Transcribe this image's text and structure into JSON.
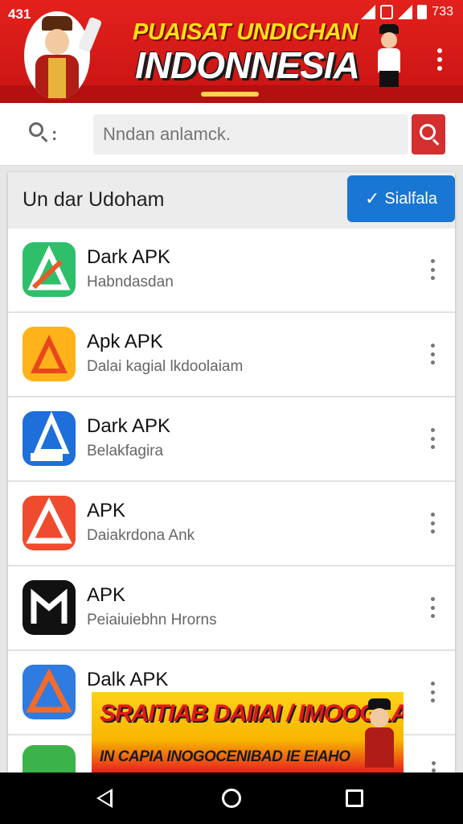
{
  "status_bar": {
    "time_left": "431",
    "time_right": "733"
  },
  "header": {
    "title_top": "PUAISAT UNDICHAN",
    "title_main": "INDONNESIA",
    "colors": {
      "primary": "#e3211d",
      "accent_yellow": "#ffe11a"
    }
  },
  "search": {
    "placeholder": "Nndan anlamck.",
    "icon": "search-icon",
    "button_icon": "search-icon"
  },
  "card": {
    "title": "Un dar Udoham",
    "action_button": {
      "label": "Sialfala",
      "icon": "edit-check-icon",
      "color": "#1976d2"
    }
  },
  "apps": [
    {
      "name": "Dark APK",
      "subtitle": "Habndasdan",
      "icon": "green-a-icon"
    },
    {
      "name": "Apk APK",
      "subtitle": "Dalai kagial lkdoolaiam",
      "icon": "orange-a-icon"
    },
    {
      "name": "Dark APK",
      "subtitle": "Belakfagira",
      "icon": "blue-apk-icon"
    },
    {
      "name": "APK",
      "subtitle": "Daiakrdona Ank",
      "icon": "red-a-icon"
    },
    {
      "name": "APK",
      "subtitle": "Peiaiuiebhn Hrorns",
      "icon": "black-m-icon"
    },
    {
      "name": "Dalk APK",
      "subtitle": "",
      "icon": "blue-triangle-icon"
    }
  ],
  "ad": {
    "line1": "SRAITIAB DAIIAI / IMOOGLAN?",
    "line2": "IN CAPIA INOGOCENIBAD IE EIAHO"
  },
  "nav": {
    "back": "back-icon",
    "home": "home-icon",
    "recent": "recent-apps-icon"
  }
}
